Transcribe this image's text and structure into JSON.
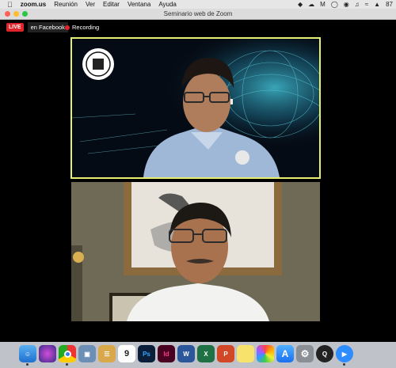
{
  "menubar": {
    "app": "zoom.us",
    "items": [
      "Reunión",
      "Ver",
      "Editar",
      "Ventana",
      "Ayuda"
    ],
    "battery": "87"
  },
  "window": {
    "title": "Seminario web de Zoom"
  },
  "meeting": {
    "live_badge": "LIVE",
    "live_destination": "en Facebook",
    "recording_label": "Recording",
    "colors": {
      "active_speaker_border": "#e6ef70",
      "live_red": "#e0242b"
    }
  },
  "dock": {
    "calendar_day": "9",
    "apps": [
      {
        "name": "finder-icon",
        "label": ""
      },
      {
        "name": "siri-icon",
        "label": ""
      },
      {
        "name": "chrome-icon",
        "label": ""
      },
      {
        "name": "preview-icon",
        "label": ""
      },
      {
        "name": "notes-icon",
        "label": ""
      },
      {
        "name": "calendar-icon",
        "label": "9"
      },
      {
        "name": "photoshop-icon",
        "label": "Ps"
      },
      {
        "name": "indesign-icon",
        "label": "Id"
      },
      {
        "name": "word-icon",
        "label": "W"
      },
      {
        "name": "excel-icon",
        "label": "X"
      },
      {
        "name": "powerpoint-icon",
        "label": "P"
      },
      {
        "name": "stickies-icon",
        "label": ""
      },
      {
        "name": "photos-icon",
        "label": ""
      },
      {
        "name": "appstore-icon",
        "label": ""
      },
      {
        "name": "system-preferences-icon",
        "label": ""
      },
      {
        "name": "quicktime-icon",
        "label": ""
      },
      {
        "name": "zoom-icon",
        "label": ""
      }
    ]
  }
}
